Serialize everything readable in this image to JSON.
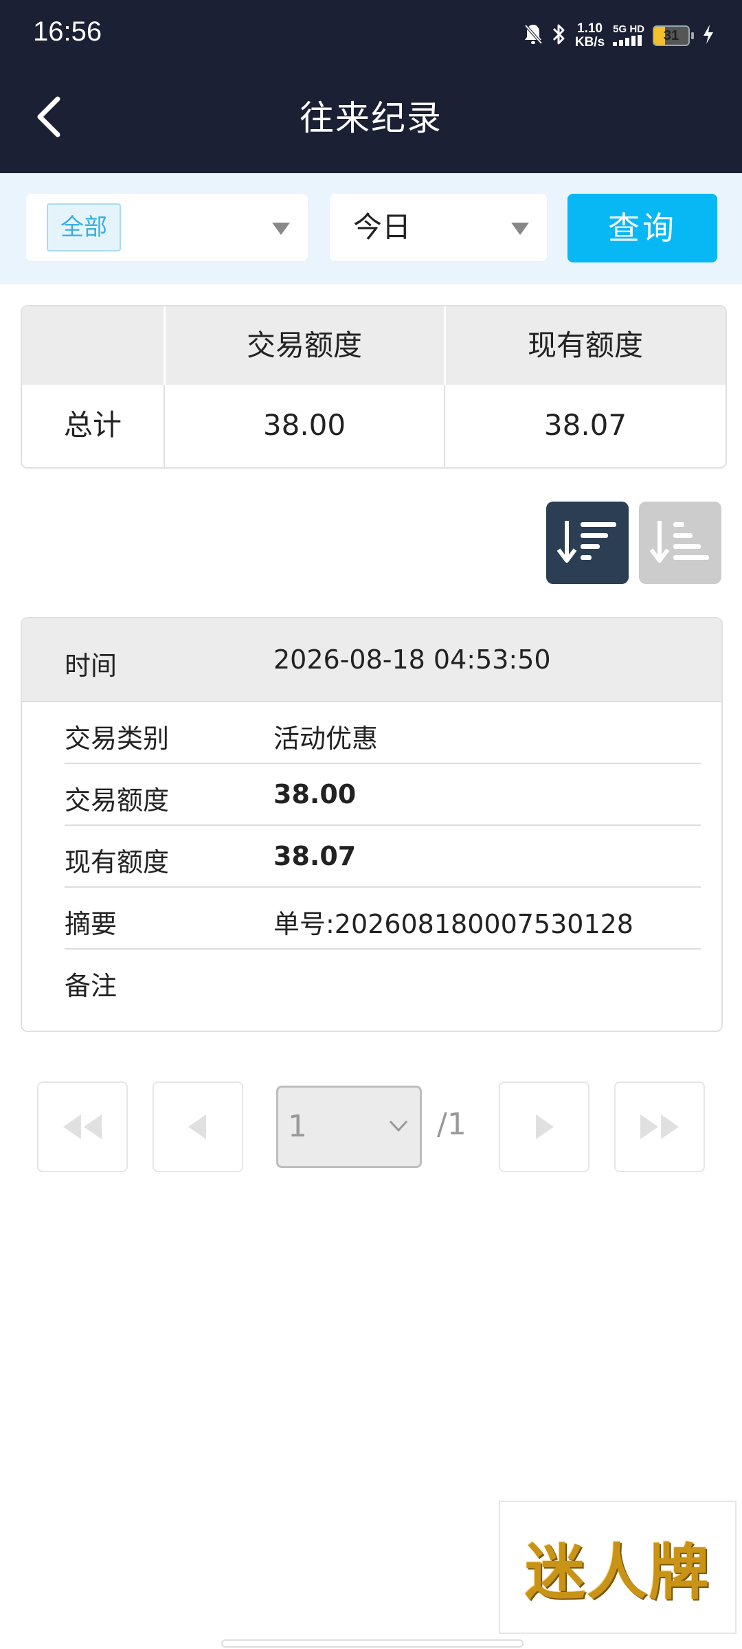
{
  "status_bar": {
    "time": "16:56",
    "net_speed_value": "1.10",
    "net_speed_unit": "KB/s",
    "net_type_top": "5G HD",
    "battery_level": "31"
  },
  "header": {
    "title": "往来纪录"
  },
  "filters": {
    "category_tag": "全部",
    "period": "今日",
    "query_label": "查询"
  },
  "summary": {
    "headers": [
      "交易额度",
      "现有额度"
    ],
    "row_label": "总计",
    "trade_amount": "38.00",
    "current_amount": "38.07"
  },
  "record": {
    "time_label": "时间",
    "time_value": "2026-08-18 04:53:50",
    "type_label": "交易类别",
    "type_value": "活动优惠",
    "trade_label": "交易额度",
    "trade_value": "38.00",
    "current_label": "现有额度",
    "current_value": "38.07",
    "summary_label": "摘要",
    "summary_value": "单号:202608180007530128",
    "note_label": "备注",
    "note_value": ""
  },
  "pagination": {
    "current_page": "1",
    "total": "/1"
  },
  "logo": {
    "text": "迷人牌"
  },
  "icons": {
    "back": "chevron-left-icon",
    "sort_desc": "sort-descending-icon",
    "sort_asc": "sort-ascending-icon",
    "first": "double-left-icon",
    "prev": "left-triangle-icon",
    "next": "right-triangle-icon",
    "last": "double-right-icon"
  },
  "colors": {
    "header_bg": "#1b2034",
    "query_button": "#07b8f5",
    "sort_active": "#2b3e54",
    "sort_inactive": "#cccccc",
    "tag_text": "#3aaee0"
  }
}
